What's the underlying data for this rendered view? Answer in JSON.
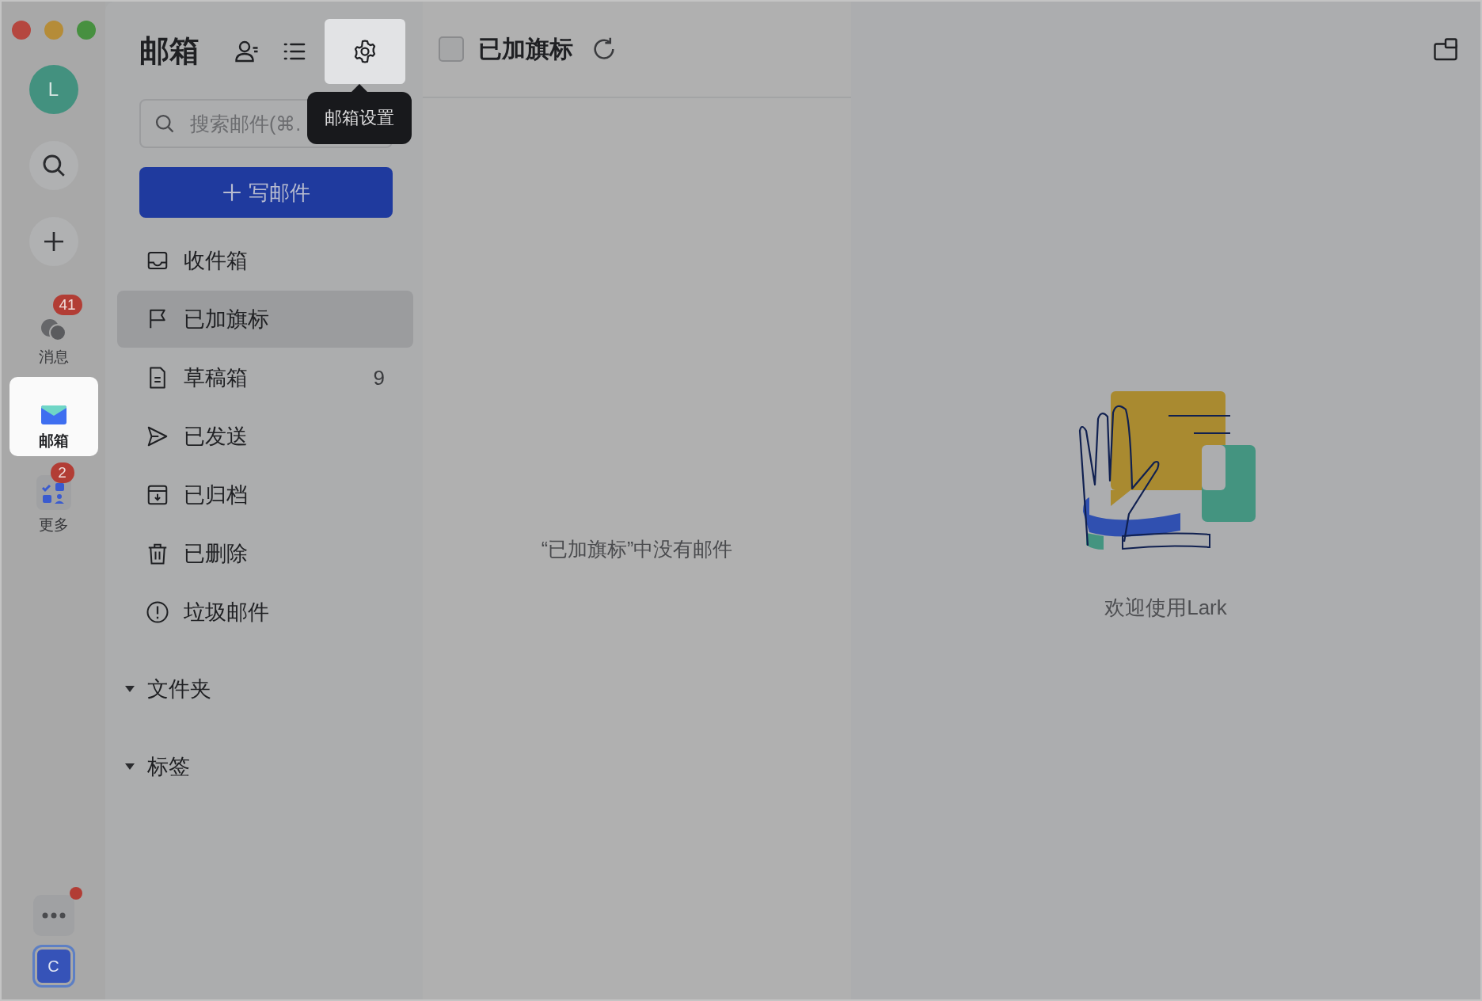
{
  "rail": {
    "avatar": {
      "letter": "L"
    },
    "apps": [
      {
        "label": "消息",
        "kind": "chat",
        "badge": "41",
        "selected": false
      },
      {
        "label": "邮箱",
        "kind": "mail",
        "selected": true
      },
      {
        "label": "更多",
        "kind": "more",
        "badge": "2",
        "selected": false
      }
    ],
    "bottom": {
      "notification_dot": true,
      "user": {
        "letter": "C"
      }
    }
  },
  "sidebar": {
    "title": "邮箱",
    "settings_tooltip": "邮箱设置",
    "search": {
      "placeholder": "搜索邮件(⌘."
    },
    "compose": {
      "label": "写邮件"
    },
    "items": [
      {
        "kind": "inbox",
        "label": "收件箱",
        "selected": false
      },
      {
        "kind": "flag",
        "label": "已加旗标",
        "selected": true
      },
      {
        "kind": "draft",
        "label": "草稿箱",
        "count": "9",
        "selected": false
      },
      {
        "kind": "sent",
        "label": "已发送",
        "selected": false
      },
      {
        "kind": "archive",
        "label": "已归档",
        "selected": false
      },
      {
        "kind": "trash",
        "label": "已删除",
        "selected": false
      },
      {
        "kind": "spam",
        "label": "垃圾邮件",
        "selected": false
      }
    ],
    "sections": [
      {
        "label": "文件夹",
        "expanded": true
      },
      {
        "label": "标签",
        "expanded": true
      }
    ]
  },
  "list": {
    "checkbox": {
      "checked": false
    },
    "title": "已加旗标",
    "empty_message": "“已加旗标”中没有邮件"
  },
  "reader": {
    "welcome": "欢迎使用Lark"
  }
}
